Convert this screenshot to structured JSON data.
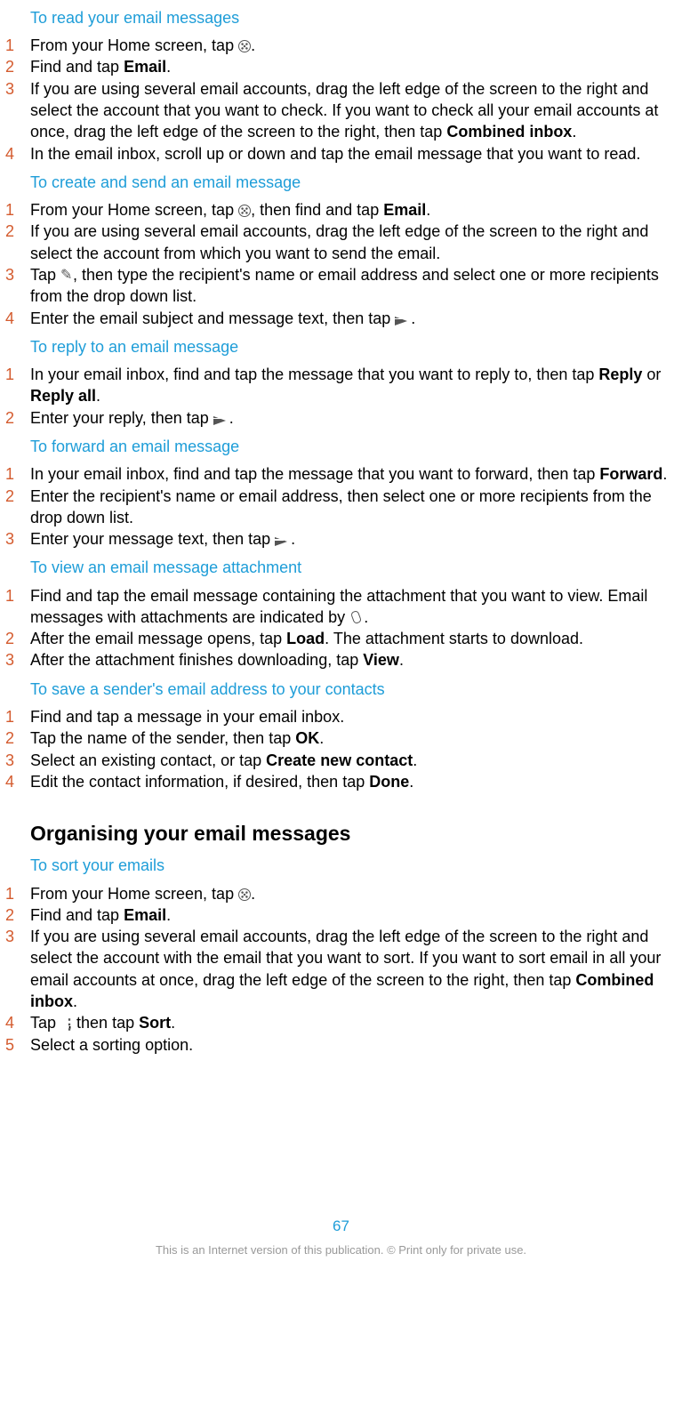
{
  "sections": [
    {
      "title": "To read your email messages",
      "steps": [
        {
          "pre": "From your Home screen, tap ",
          "icon": "apps",
          "post": "."
        },
        {
          "pre": "Find and tap ",
          "bold1": "Email",
          "post": "."
        },
        {
          "text": "If you are using several email accounts, drag the left edge of the screen to the right and select the account that you want to check. If you want to check all your email accounts at once, drag the left edge of the screen to the right, then tap ",
          "bold1": "Combined inbox",
          "post": "."
        },
        {
          "text": "In the email inbox, scroll up or down and tap the email message that you want to read."
        }
      ]
    },
    {
      "title": "To create and send an email message",
      "steps": [
        {
          "pre": "From your Home screen, tap ",
          "icon": "apps",
          "mid": ", then find and tap ",
          "bold1": "Email",
          "post": "."
        },
        {
          "text": "If you are using several email accounts, drag the left edge of the screen to the right and select the account from which you want to send the email."
        },
        {
          "pre": "Tap ",
          "icon": "compose",
          "post": ", then type the recipient's name or email address and select one or more recipients from the drop down list."
        },
        {
          "pre": "Enter the email subject and message text, then tap ",
          "icon": "send",
          "post": "."
        }
      ]
    },
    {
      "title": "To reply to an email message",
      "steps": [
        {
          "pre": "In your email inbox, find and tap the message that you want to reply to, then tap ",
          "bold1": "Reply",
          "mid": " or ",
          "bold2": "Reply all",
          "post": "."
        },
        {
          "pre": "Enter your reply, then tap ",
          "icon": "send",
          "post": "."
        }
      ]
    },
    {
      "title": "To forward an email message",
      "steps": [
        {
          "pre": "In your email inbox, find and tap the message that you want to forward, then tap ",
          "bold1": "Forward",
          "post": "."
        },
        {
          "text": "Enter the recipient's name or email address, then select one or more recipients from the drop down list."
        },
        {
          "pre": "Enter your message text, then tap ",
          "icon": "send",
          "post": "."
        }
      ]
    },
    {
      "title": "To view an email message attachment",
      "steps": [
        {
          "pre": "Find and tap the email message containing the attachment that you want to view. Email messages with attachments are indicated by ",
          "icon": "attach",
          "post": "."
        },
        {
          "pre": "After the email message opens, tap ",
          "bold1": "Load",
          "post": ". The attachment starts to download."
        },
        {
          "pre": "After the attachment finishes downloading, tap ",
          "bold1": "View",
          "post": "."
        }
      ]
    },
    {
      "title": "To save a sender's email address to your contacts",
      "steps": [
        {
          "text": "Find and tap a message in your email inbox."
        },
        {
          "pre": "Tap the name of the sender, then tap ",
          "bold1": "OK",
          "post": "."
        },
        {
          "pre": "Select an existing contact, or tap ",
          "bold1": "Create new contact",
          "post": "."
        },
        {
          "pre": "Edit the contact information, if desired, then tap ",
          "bold1": "Done",
          "post": "."
        }
      ]
    }
  ],
  "main_heading": "Organising your email messages",
  "sections2": [
    {
      "title": "To sort your emails",
      "steps": [
        {
          "pre": "From your Home screen, tap ",
          "icon": "apps",
          "post": "."
        },
        {
          "pre": "Find and tap ",
          "bold1": "Email",
          "post": "."
        },
        {
          "text": "If you are using several email accounts, drag the left edge of the screen to the right and select the account with the email that you want to sort. If you want to sort email in all your email accounts at once, drag the left edge of the screen to the right, then tap ",
          "bold1": "Combined inbox",
          "post": "."
        },
        {
          "pre": "Tap ",
          "icon": "menu",
          "mid": ", then tap ",
          "bold1": "Sort",
          "post": "."
        },
        {
          "text": "Select a sorting option."
        }
      ]
    }
  ],
  "page_number": "67",
  "footer": "This is an Internet version of this publication. © Print only for private use."
}
